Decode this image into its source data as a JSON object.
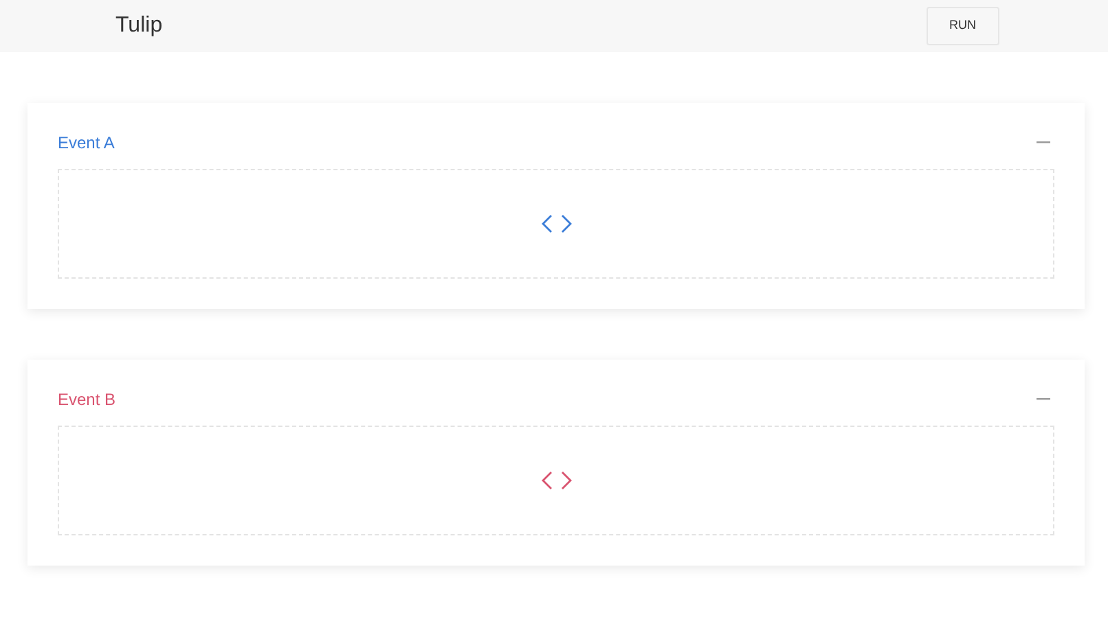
{
  "app": {
    "title": "Tulip",
    "run_button": "RUN"
  },
  "events": [
    {
      "title": "Event A",
      "color": "#3b7dd8"
    },
    {
      "title": "Event B",
      "color": "#d9536f"
    }
  ]
}
